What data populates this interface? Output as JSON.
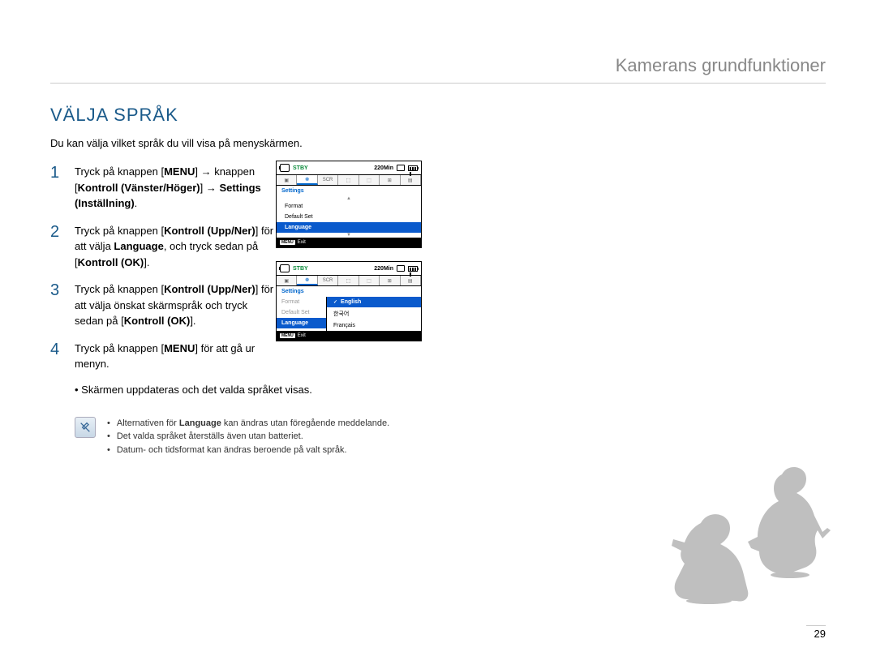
{
  "header": {
    "chapter": "Kamerans grundfunktioner"
  },
  "title": "VÄLJA SPRÅK",
  "intro": "Du kan välja vilket språk du vill visa på menyskärmen.",
  "steps": [
    {
      "num": "1",
      "parts": [
        "Tryck på knappen [",
        "MENU",
        "] ",
        "→",
        " knappen [",
        "Kontroll (Vänster/Höger)",
        "] ",
        "→",
        " ",
        "Settings (Inställning)",
        "."
      ]
    },
    {
      "num": "2",
      "parts": [
        "Tryck på knappen [",
        "Kontroll (Upp/Ner)",
        "] för att välja ",
        "Language",
        ", och tryck sedan på [",
        "Kontroll (OK)",
        "]."
      ]
    },
    {
      "num": "3",
      "parts": [
        "Tryck på knappen [",
        "Kontroll (Upp/Ner)",
        "] för att välja önskat skärmspråk och tryck sedan på [",
        "Kontroll (OK)",
        "]."
      ]
    },
    {
      "num": "4",
      "parts": [
        "Tryck på knappen [",
        "MENU",
        "] för att gå ur menyn."
      ]
    }
  ],
  "sub_bullet": "Skärmen uppdateras och det valda språket visas.",
  "notes": [
    {
      "pre": "Alternativen för ",
      "bold": "Language",
      "post": " kan ändras utan föregående meddelande."
    },
    {
      "pre": "Det valda språket återställs även utan batteriet.",
      "bold": "",
      "post": ""
    },
    {
      "pre": "Datum- och tidsformat kan ändras beroende på valt språk.",
      "bold": "",
      "post": ""
    }
  ],
  "lcd": {
    "stby": "STBY",
    "time": "220Min",
    "settings": "Settings",
    "format": "Format",
    "default_set": "Default Set",
    "language": "Language",
    "exit": "Exit",
    "menu_badge": "MENU",
    "lang_opts": {
      "english": "English",
      "korean": "한국어",
      "francais": "Français"
    }
  },
  "page_number": "29"
}
